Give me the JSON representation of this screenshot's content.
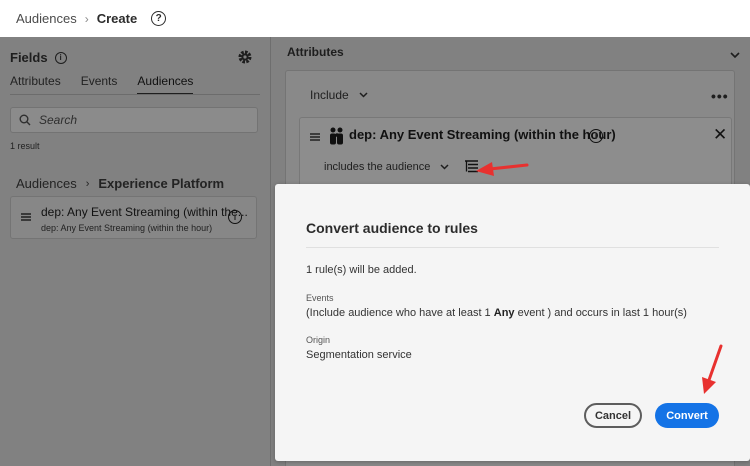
{
  "header": {
    "breadcrumb_root": "Audiences",
    "breadcrumb_current": "Create",
    "help_glyph": "?"
  },
  "left_panel": {
    "title": "Fields",
    "tabs": [
      {
        "label": "Attributes",
        "active": false
      },
      {
        "label": "Events",
        "active": false
      },
      {
        "label": "Audiences",
        "active": true
      }
    ],
    "search_placeholder": "Search",
    "result_count": "1 result",
    "folder_breadcrumb": {
      "root": "Audiences",
      "current": "Experience Platform"
    },
    "audience_item": {
      "title": "dep: Any Event Streaming (within the...",
      "subtitle": "dep: Any Event Streaming (within the hour)"
    }
  },
  "right_panel": {
    "title": "Attributes",
    "include_label": "Include",
    "condition": {
      "title": "dep: Any Event Streaming (within the hour)",
      "operator_label": "includes the audience"
    }
  },
  "modal": {
    "title": "Convert audience to rules",
    "message": "1 rule(s) will be added.",
    "events_label": "Events",
    "events_value_prefix": "(Include audience who have at least 1",
    "events_value_emphasis": "Any",
    "events_value_suffix": "event ) and occurs in last 1 hour(s)",
    "origin_label": "Origin",
    "origin_value": "Segmentation service",
    "cancel_label": "Cancel",
    "convert_label": "Convert"
  },
  "colors": {
    "accent_blue": "#1473e6",
    "annotation_red": "#e8312f",
    "overlay_gray": "#818181"
  },
  "icons": [
    "help-icon",
    "info-icon",
    "gear-icon",
    "search-icon",
    "drag-handle-icon",
    "people-icon",
    "close-icon",
    "chevron-down-icon",
    "more-icon",
    "tree-icon"
  ]
}
